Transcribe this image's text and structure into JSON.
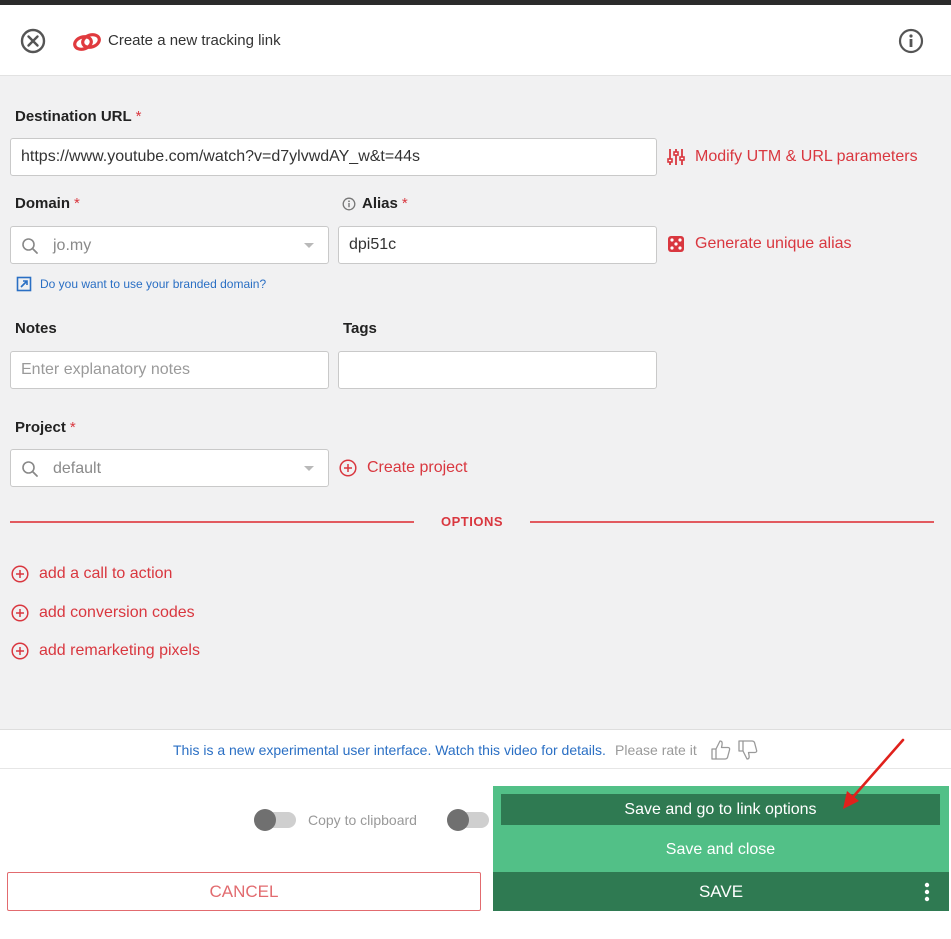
{
  "header": {
    "title": "Create a new tracking link",
    "close_icon": "close-circle-icon",
    "info_icon": "info-circle-icon",
    "logo_icon": "link-logo-icon"
  },
  "form": {
    "destination": {
      "label": "Destination URL",
      "required_mark": "*",
      "value": "https://www.youtube.com/watch?v=d7ylvwdAY_w&t=44s",
      "utm_link": "Modify UTM & URL parameters"
    },
    "domain": {
      "label": "Domain",
      "required_mark": "*",
      "value": "jo.my",
      "branded_link": "Do you want to use your branded domain?"
    },
    "alias": {
      "label": "Alias",
      "required_mark": "*",
      "value": "dpi51c",
      "generate_link": "Generate unique alias"
    },
    "notes": {
      "label": "Notes",
      "placeholder": "Enter explanatory notes"
    },
    "tags": {
      "label": "Tags",
      "value": ""
    },
    "project": {
      "label": "Project",
      "required_mark": "*",
      "value": "default",
      "create_link": "Create project"
    }
  },
  "options": {
    "title": "OPTIONS",
    "items": [
      {
        "label": "add a call to action"
      },
      {
        "label": "add conversion codes"
      },
      {
        "label": "add remarketing pixels"
      }
    ]
  },
  "notice": {
    "text": "This is a new experimental user interface. Watch this video for details.",
    "rate_text": "Please rate it"
  },
  "footer": {
    "copy_label": "Copy to clipboard",
    "cancel_label": "CANCEL",
    "save_label": "SAVE",
    "menu": {
      "save_go_options": "Save and go to link options",
      "save_close": "Save and close"
    }
  },
  "colors": {
    "accent_red": "#d9373f",
    "link_blue": "#2a6fc4",
    "save_green_dark": "#2f7a52",
    "save_green_light": "#52c087",
    "form_bg": "#f1f1f2"
  }
}
